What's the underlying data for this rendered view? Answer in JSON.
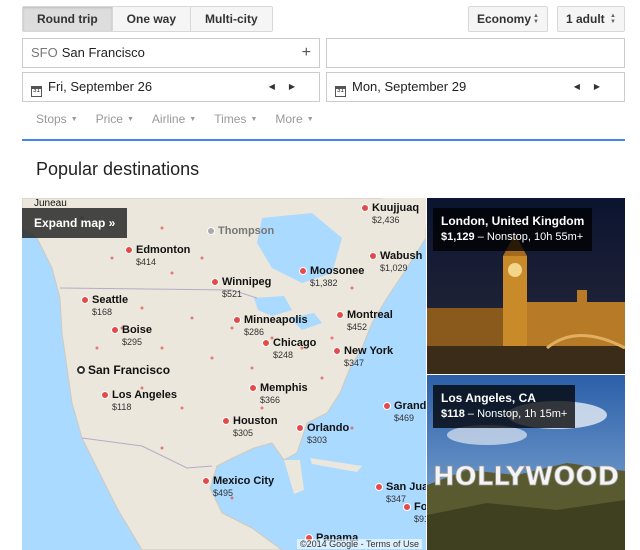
{
  "trip_types": [
    {
      "label": "Round trip",
      "active": true
    },
    {
      "label": "One way",
      "active": false
    },
    {
      "label": "Multi-city",
      "active": false
    }
  ],
  "cabin": "Economy",
  "passengers": "1 adult",
  "origin": {
    "code": "SFO",
    "name": "San Francisco"
  },
  "destination": {
    "placeholder": ""
  },
  "depart_date": "Fri, September 26",
  "return_date": "Mon, September 29",
  "filters": [
    "Stops",
    "Price",
    "Airline",
    "Times",
    "More"
  ],
  "section_title": "Popular destinations",
  "map": {
    "expand_label": "Expand map »",
    "copyright": "©2014 Google - Terms of Use",
    "origin_label": "San Francisco",
    "grey_label": "Thompson",
    "top_label": "Juneau",
    "cities": [
      {
        "name": "Kuujjuaq",
        "price": "$2,436"
      },
      {
        "name": "Edmonton",
        "price": "$414"
      },
      {
        "name": "Wabush",
        "price": "$1,029"
      },
      {
        "name": "Winnipeg",
        "price": "$521"
      },
      {
        "name": "Moosonee",
        "price": "$1,382"
      },
      {
        "name": "Seattle",
        "price": "$168"
      },
      {
        "name": "Minneapolis",
        "price": "$286"
      },
      {
        "name": "Montreal",
        "price": "$452"
      },
      {
        "name": "Boise",
        "price": "$295"
      },
      {
        "name": "Chicago",
        "price": "$248"
      },
      {
        "name": "New York",
        "price": "$347"
      },
      {
        "name": "Los Angeles",
        "price": "$118"
      },
      {
        "name": "Memphis",
        "price": "$366"
      },
      {
        "name": "Grand",
        "price": "$469"
      },
      {
        "name": "Houston",
        "price": "$305"
      },
      {
        "name": "Orlando",
        "price": "$303"
      },
      {
        "name": "Mexico City",
        "price": "$495"
      },
      {
        "name": "San Jua",
        "price": "$347"
      },
      {
        "name": "Fo",
        "price": "$91"
      },
      {
        "name": "Panama",
        "price": ""
      }
    ]
  },
  "cards": [
    {
      "name": "London, United Kingdom",
      "price": "$1,129",
      "detail": " – Nonstop, 10h 55m+"
    },
    {
      "name": "Los Angeles, CA",
      "price": "$118",
      "detail": " – Nonstop, 1h 15m+"
    }
  ],
  "hollywood_sign": "HOLLYWOOD"
}
